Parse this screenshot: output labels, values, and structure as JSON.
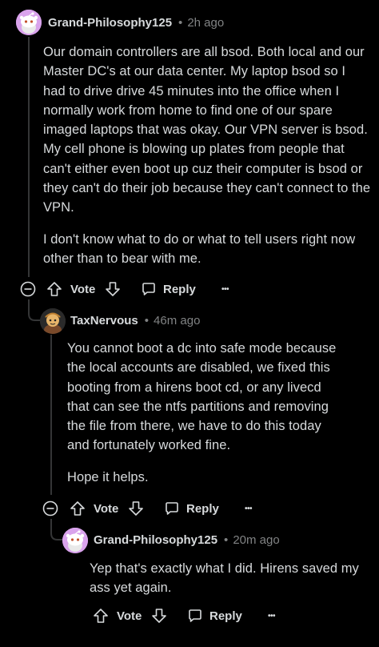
{
  "comments": [
    {
      "username": "Grand-Philosophy125",
      "separator": "•",
      "time": "2h ago",
      "paragraphs": [
        "Our domain controllers are all bsod. Both local and our Master DC's at our data center. My laptop bsod so I had to drive drive 45 minutes into the office when I normally work from home to find one of our spare imaged laptops that was okay. Our VPN server is bsod. My cell phone is blowing up plates from people that can't either even boot up cuz their computer is bsod or they can't do their job because they can't connect to the VPN.",
        "I don't know what to do or what to tell users right now other than to bear with me."
      ],
      "vote_label": "Vote",
      "reply_label": "Reply",
      "more_label": "•••"
    },
    {
      "username": "TaxNervous",
      "separator": "•",
      "time": "46m ago",
      "paragraphs": [
        "You cannot boot a dc into safe mode because the local accounts are disabled, we fixed this booting from a hirens boot cd, or any livecd that can see the ntfs partitions and removing the file from there, we have to do this today and fortunately worked fine.",
        "Hope it helps."
      ],
      "vote_label": "Vote",
      "reply_label": "Reply",
      "more_label": "•••"
    },
    {
      "username": "Grand-Philosophy125",
      "separator": "•",
      "time": "20m ago",
      "paragraphs": [
        "Yep that's exactly what I did. Hirens saved my ass yet again."
      ],
      "vote_label": "Vote",
      "reply_label": "Reply",
      "more_label": "•••"
    }
  ],
  "colors": {
    "background": "#000000",
    "text": "#d7dadc",
    "muted": "#818384",
    "thread_line": "#343536",
    "avatar_pink": "#d9a3ec"
  },
  "icons": [
    "snoo-avatar",
    "custom-avatar",
    "collapse-icon",
    "upvote-icon",
    "downvote-icon",
    "reply-icon",
    "more-icon"
  ]
}
